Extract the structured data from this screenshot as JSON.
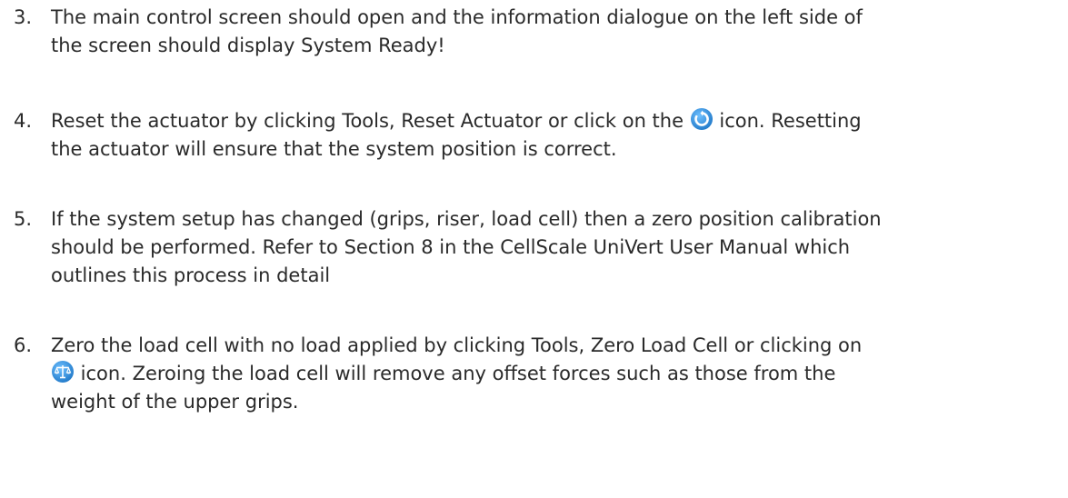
{
  "items": [
    {
      "number": "3.",
      "lines": [
        "The main control screen should open and the information dialogue on the left side of",
        "the screen should display System Ready!"
      ]
    },
    {
      "number": "4.",
      "line1_before_icon": "Reset the actuator by clicking Tools, Reset Actuator or click on the",
      "icon": "reset-circular-arrow-icon",
      "line1_after_icon": " icon. Resetting",
      "line2": "the actuator will ensure that the system position is correct."
    },
    {
      "number": "5.",
      "lines": [
        "If the system setup has changed (grips, riser, load cell) then a zero position calibration",
        "should be performed. Refer to Section 8 in the CellScale UniVert User Manual which",
        "outlines this process in detail"
      ]
    },
    {
      "number": "6.",
      "line1": "Zero the load cell with no load applied by clicking Tools, Zero Load Cell or clicking on",
      "icon": "balance-scale-icon",
      "line2_after_icon": " icon. Zeroing the load cell will remove any offset forces such as those from the",
      "line3": "weight of the upper grips."
    }
  ],
  "colors": {
    "text": "#2a2a2a",
    "icon_blue": "#3a97e0",
    "icon_blue_dark": "#1f78c8"
  }
}
